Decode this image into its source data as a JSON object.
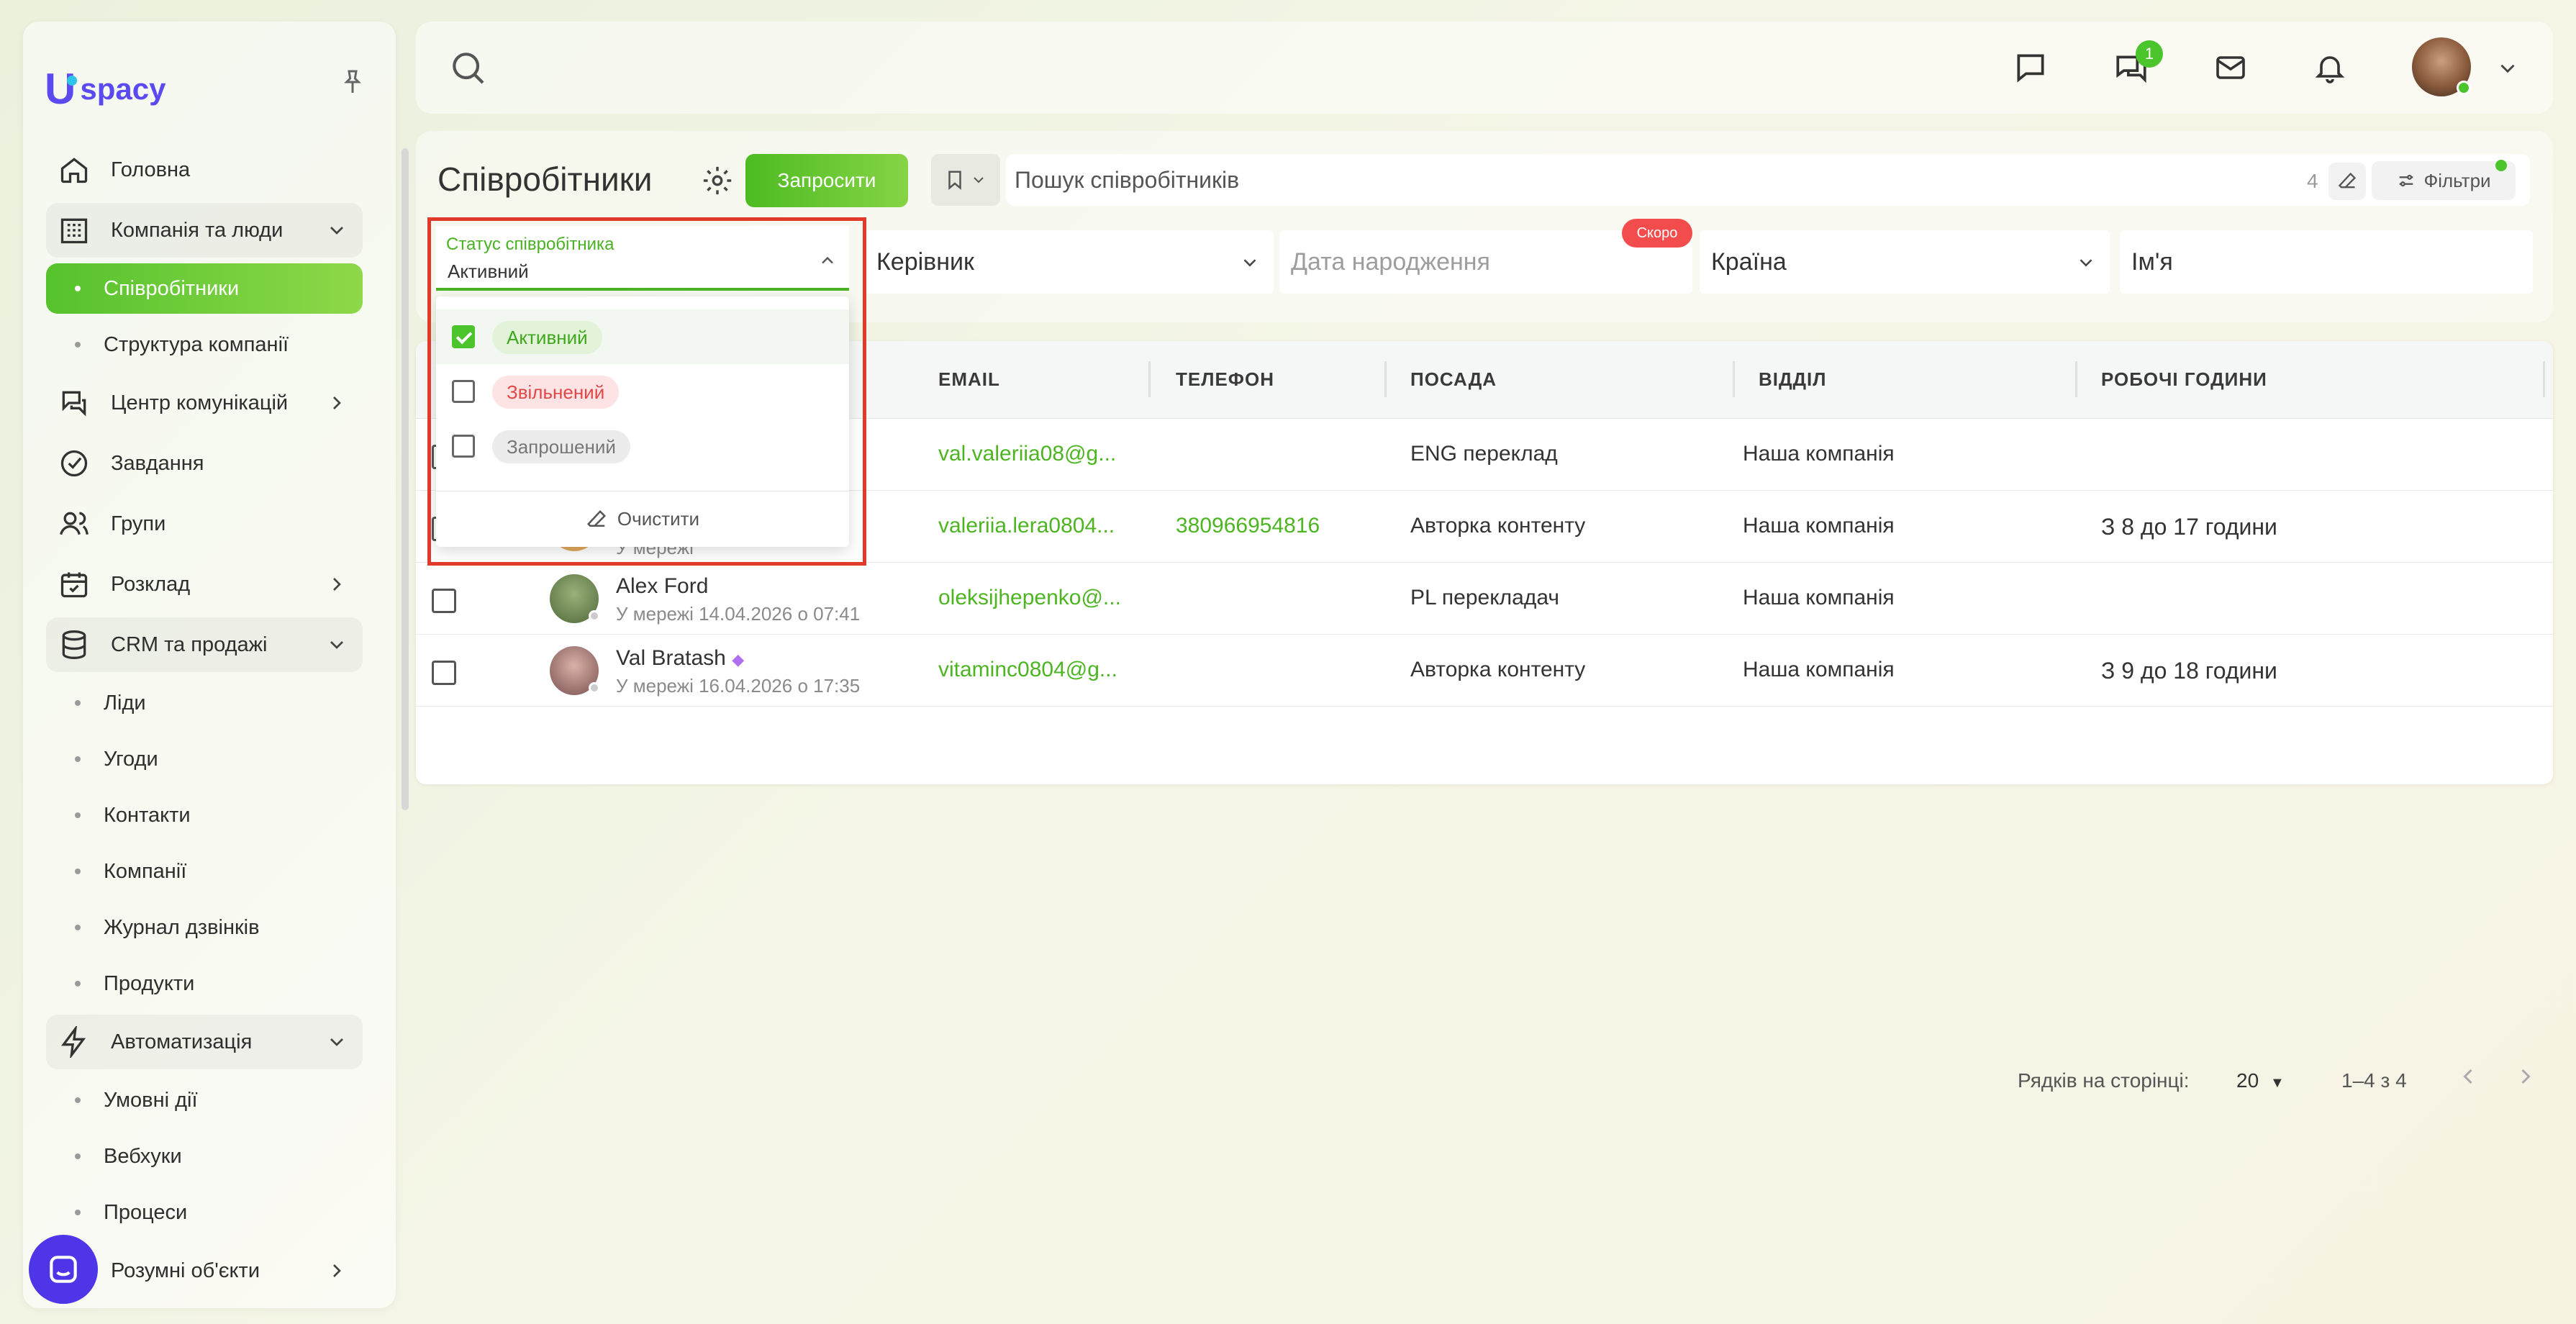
{
  "app": {
    "logo_u": "U",
    "logo_rest": "spacy"
  },
  "sidebar": {
    "items": [
      {
        "label": "Головна",
        "icon": "home-icon"
      },
      {
        "label": "Компанія та люди",
        "icon": "building-icon",
        "expanded": true
      },
      {
        "label": "Співробітники",
        "sub": true,
        "active": true
      },
      {
        "label": "Структура компанії",
        "sub": true
      },
      {
        "label": "Центр комунікацій",
        "icon": "chat-bubbles-icon"
      },
      {
        "label": "Завдання",
        "icon": "check-circle-icon"
      },
      {
        "label": "Групи",
        "icon": "users-icon"
      },
      {
        "label": "Розклад",
        "icon": "calendar-icon"
      },
      {
        "label": "CRM та продажі",
        "icon": "database-icon",
        "expanded": true
      },
      {
        "label": "Ліди",
        "sub": true
      },
      {
        "label": "Угоди",
        "sub": true
      },
      {
        "label": "Контакти",
        "sub": true
      },
      {
        "label": "Компанії",
        "sub": true
      },
      {
        "label": "Журнал дзвінків",
        "sub": true
      },
      {
        "label": "Продукти",
        "sub": true
      },
      {
        "label": "Автоматизація",
        "icon": "lightning-icon",
        "expanded": true
      },
      {
        "label": "Умовні дії",
        "sub": true
      },
      {
        "label": "Вебхуки",
        "sub": true
      },
      {
        "label": "Процеси",
        "sub": true
      },
      {
        "label": "Розумні об'єкти",
        "icon": "cube-icon"
      }
    ]
  },
  "topbar": {
    "chat_badge": "1"
  },
  "page": {
    "title": "Співробітники",
    "invite_label": "Запросити",
    "search_placeholder": "Пошук співробітників",
    "search_count": "4",
    "filters_label": "Фільтри"
  },
  "filters": {
    "status_label": "Статус співробітника",
    "status_value": "Активний",
    "manager": "Керівник",
    "birth_date": "Дата народження",
    "soon_badge": "Скоро",
    "country": "Країна",
    "name": "Ім'я"
  },
  "dropdown": {
    "options": [
      {
        "label": "Активний",
        "checked": true,
        "color": "#3ea71b"
      },
      {
        "label": "Звільнений",
        "checked": false,
        "color": "#e04848"
      },
      {
        "label": "Запрошений",
        "checked": false,
        "color": "#777777"
      }
    ],
    "clear_label": "Очистити"
  },
  "table": {
    "columns": [
      "EMAIL",
      "ТЕЛЕФОН",
      "ПОСАДА",
      "ВІДДІЛ",
      "РОБОЧІ ГОДИНИ"
    ],
    "rows": [
      {
        "name": "",
        "status": "",
        "email": "val.valeriia08@g...",
        "phone": "",
        "position": "ENG переклад",
        "department": "Наша компанія",
        "hours": ""
      },
      {
        "name": "",
        "status": "У мережі",
        "email": "valeriia.lera0804...",
        "phone": "380966954816",
        "position": "Авторка контенту",
        "department": "Наша компанія",
        "hours": "З 8 до 17 години"
      },
      {
        "name": "Alex Ford",
        "status": "У мережі 14.04.2026 о 07:41",
        "email": "oleksijhepenko@...",
        "phone": "",
        "position": "PL перекладач",
        "department": "Наша компанія",
        "hours": ""
      },
      {
        "name": "Val Bratash",
        "status": "У мережі 16.04.2026 о 17:35",
        "email": "vitaminc0804@g...",
        "phone": "",
        "position": "Авторка контенту",
        "department": "Наша компанія",
        "hours": "З 9 до 18 години"
      }
    ]
  },
  "pagination": {
    "rows_label": "Рядків на сторінці:",
    "rows_value": "20",
    "range": "1–4 з 4"
  },
  "colors": {
    "accent": "#4cc42c",
    "brand": "#5b4af0",
    "highlight": "#e23a2a"
  }
}
